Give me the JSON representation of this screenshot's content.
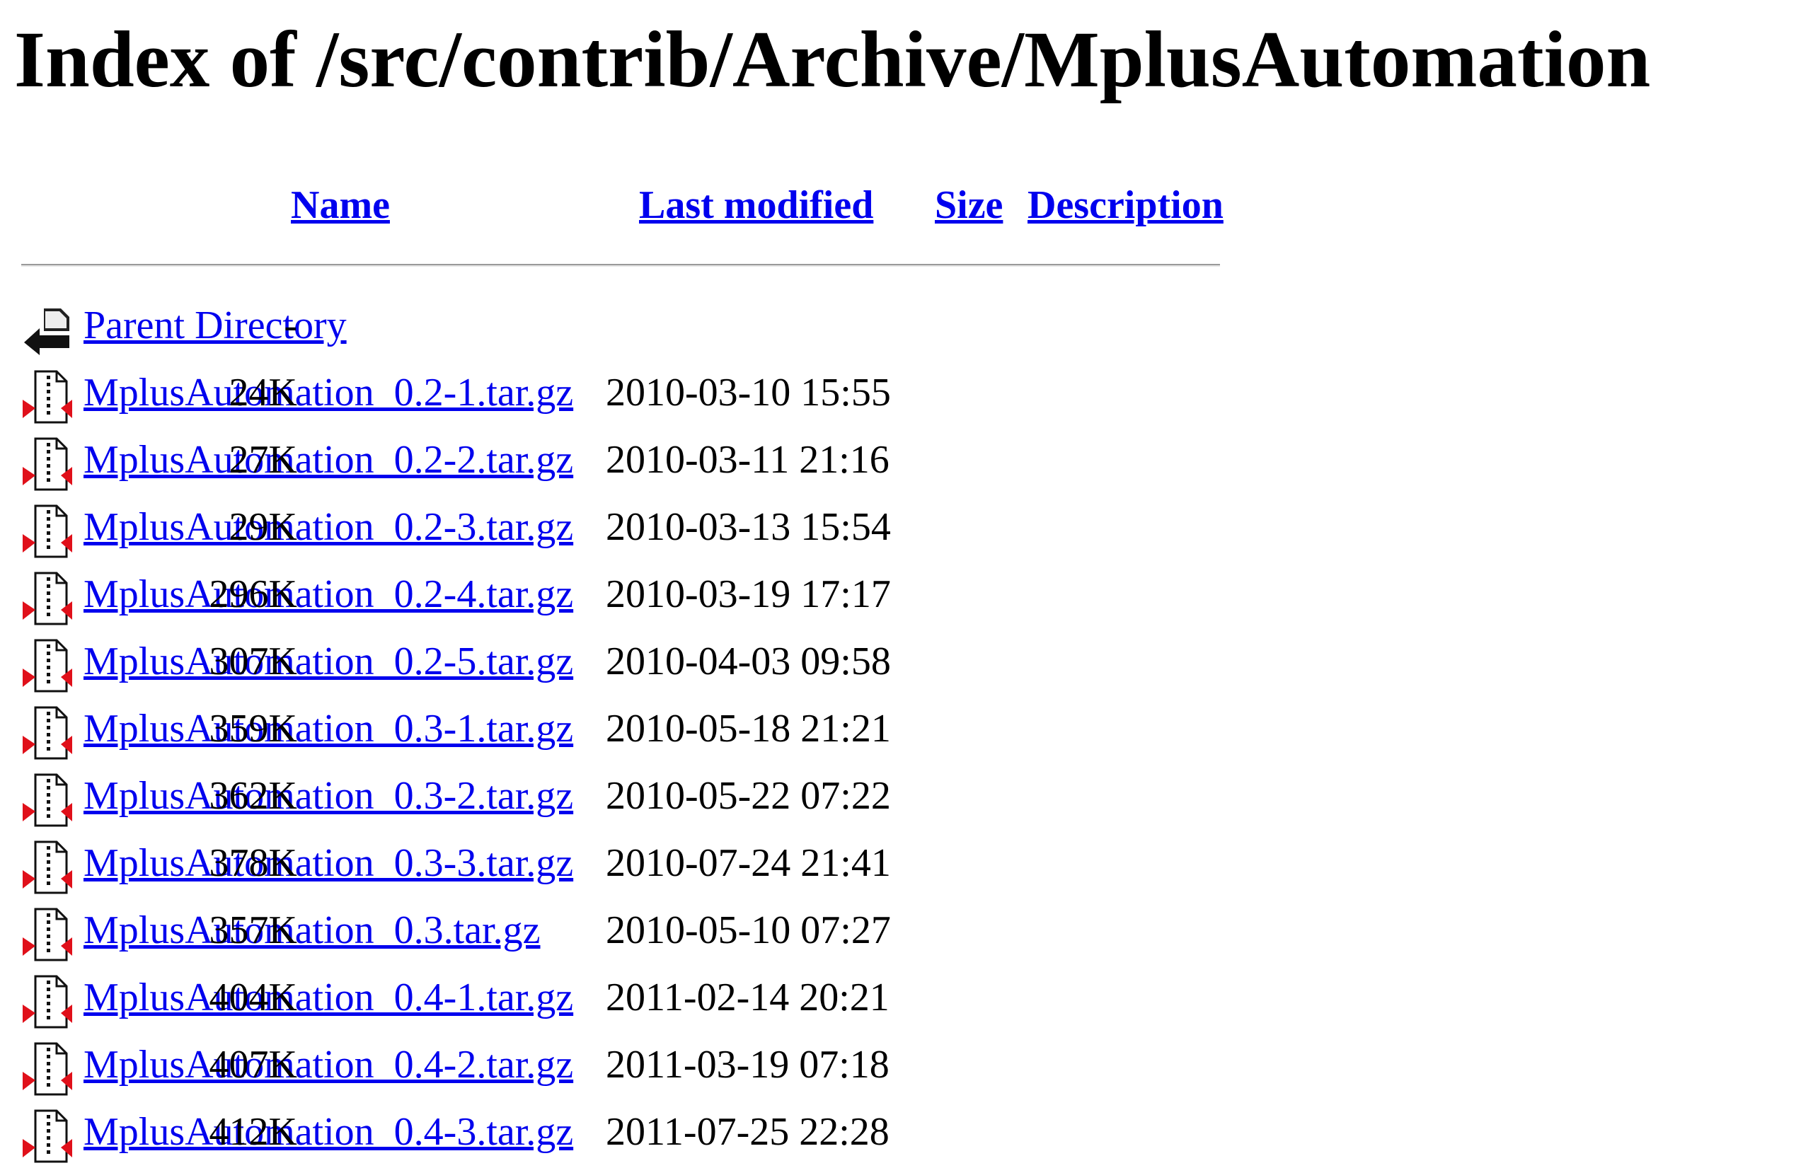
{
  "title": "Index of /src/contrib/Archive/MplusAutomation",
  "columns": {
    "name": "Name",
    "last_modified": "Last modified",
    "size": "Size",
    "description": "Description"
  },
  "parent": {
    "name": "Parent Directory",
    "size": "-",
    "icon": "back-arrow-icon"
  },
  "files": [
    {
      "name": "MplusAutomation_0.2-1.tar.gz",
      "date": "2010-03-10 15:55",
      "size": "24K",
      "icon": "compressed-file-icon"
    },
    {
      "name": "MplusAutomation_0.2-2.tar.gz",
      "date": "2010-03-11 21:16",
      "size": "27K",
      "icon": "compressed-file-icon"
    },
    {
      "name": "MplusAutomation_0.2-3.tar.gz",
      "date": "2010-03-13 15:54",
      "size": "29K",
      "icon": "compressed-file-icon"
    },
    {
      "name": "MplusAutomation_0.2-4.tar.gz",
      "date": "2010-03-19 17:17",
      "size": "296K",
      "icon": "compressed-file-icon"
    },
    {
      "name": "MplusAutomation_0.2-5.tar.gz",
      "date": "2010-04-03 09:58",
      "size": "307K",
      "icon": "compressed-file-icon"
    },
    {
      "name": "MplusAutomation_0.3-1.tar.gz",
      "date": "2010-05-18 21:21",
      "size": "359K",
      "icon": "compressed-file-icon"
    },
    {
      "name": "MplusAutomation_0.3-2.tar.gz",
      "date": "2010-05-22 07:22",
      "size": "362K",
      "icon": "compressed-file-icon"
    },
    {
      "name": "MplusAutomation_0.3-3.tar.gz",
      "date": "2010-07-24 21:41",
      "size": "378K",
      "icon": "compressed-file-icon"
    },
    {
      "name": "MplusAutomation_0.3.tar.gz",
      "date": "2010-05-10 07:27",
      "size": "357K",
      "icon": "compressed-file-icon"
    },
    {
      "name": "MplusAutomation_0.4-1.tar.gz",
      "date": "2011-02-14 20:21",
      "size": "404K",
      "icon": "compressed-file-icon"
    },
    {
      "name": "MplusAutomation_0.4-2.tar.gz",
      "date": "2011-03-19 07:18",
      "size": "407K",
      "icon": "compressed-file-icon"
    },
    {
      "name": "MplusAutomation_0.4-3.tar.gz",
      "date": "2011-07-25 22:28",
      "size": "412K",
      "icon": "compressed-file-icon"
    }
  ],
  "colors": {
    "link": "#0000ee",
    "text": "#000000",
    "icon_red": "#e0101a"
  }
}
